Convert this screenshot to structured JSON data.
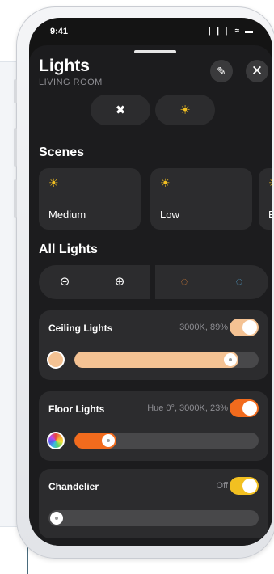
{
  "status_bar": {
    "time": "9:41",
    "icons": "❙❙❙ ≈ ▬"
  },
  "header": {
    "title": "Lights",
    "room": "LIVING ROOM",
    "edit_icon": "✎",
    "close_icon": "✕"
  },
  "power": {
    "off_icon": "✖",
    "on_icon": "☀"
  },
  "scenes": {
    "heading": "Scenes",
    "items": [
      {
        "label": "Medium",
        "icon": "☀"
      },
      {
        "label": "Low",
        "icon": "☀"
      },
      {
        "label": "E",
        "icon": "☀"
      }
    ]
  },
  "all_lights": {
    "heading": "All Lights",
    "controls": [
      {
        "icon": "⊝",
        "color": "#ffffff"
      },
      {
        "icon": "⊕",
        "color": "#ffffff"
      },
      {
        "icon": "◌",
        "color": "#f08a3a"
      },
      {
        "icon": "◌",
        "color": "#5ab4e8"
      }
    ]
  },
  "lights": [
    {
      "name": "Ceiling Lights",
      "value": "3000K, 89%",
      "on": true,
      "toggle_color": "#f4c293",
      "fill_color": "#f4c293",
      "swatch_color": "#f4c293",
      "level": 0.89
    },
    {
      "name": "Floor Lights",
      "value": "Hue 0°, 3000K, 23%",
      "on": true,
      "toggle_color": "#f26b1d",
      "fill_color": "#f26b1d",
      "swatch_color": "#f26b1d",
      "level": 0.23
    },
    {
      "name": "Chandelier",
      "value": "Off",
      "on": false,
      "toggle_color": "#f2c021",
      "fill_color": "#48484a",
      "swatch_color": "#ffffff",
      "level": 0.0
    }
  ]
}
